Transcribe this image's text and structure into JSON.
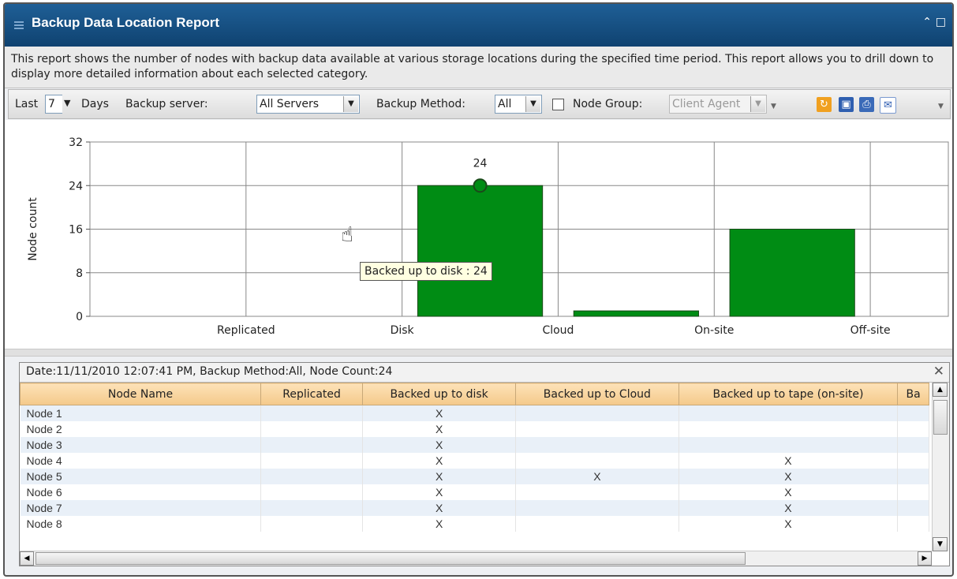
{
  "window": {
    "title": "Backup Data Location Report"
  },
  "description": "This report shows the number of nodes with backup data available at various storage locations during the specified time period. This report allows you to drill down to display more detailed information about each selected category.",
  "toolbar": {
    "last_label": "Last",
    "days_value": "7",
    "days_label": "Days",
    "server_label": "Backup server:",
    "server_value": "All Servers",
    "method_label": "Backup Method:",
    "method_value": "All",
    "node_group_label": "Node Group:",
    "node_group_value": "Client Agent",
    "icons": [
      "refresh-icon",
      "save-icon",
      "print-icon",
      "email-icon"
    ]
  },
  "chart_data": {
    "type": "bar",
    "categories": [
      "Replicated",
      "Disk",
      "Cloud",
      "On-site",
      "Off-site"
    ],
    "values": [
      0,
      24,
      1,
      16,
      0
    ],
    "ylabel": "Node count",
    "xlabel": "",
    "ylim": [
      0,
      32
    ],
    "yticks": [
      0,
      8,
      16,
      24,
      32
    ],
    "highlight": {
      "category": "Disk",
      "label": "24"
    },
    "bar_color": "#008c14",
    "grid": true
  },
  "tooltip": "Backed up to disk : 24",
  "detail": {
    "summary": "Date:11/11/2010 12:07:41 PM, Backup Method:All, Node Count:24",
    "columns": [
      "Node Name",
      "Replicated",
      "Backed up to disk",
      "Backed up to Cloud",
      "Backed up to tape (on-site)",
      "Ba"
    ],
    "rows": [
      [
        "Node 1",
        "",
        "X",
        "",
        "",
        ""
      ],
      [
        "Node 2",
        "",
        "X",
        "",
        "",
        ""
      ],
      [
        "Node 3",
        "",
        "X",
        "",
        "",
        ""
      ],
      [
        "Node 4",
        "",
        "X",
        "",
        "X",
        ""
      ],
      [
        "Node 5",
        "",
        "X",
        "X",
        "X",
        ""
      ],
      [
        "Node 6",
        "",
        "X",
        "",
        "X",
        ""
      ],
      [
        "Node 7",
        "",
        "X",
        "",
        "X",
        ""
      ],
      [
        "Node 8",
        "",
        "X",
        "",
        "X",
        ""
      ]
    ]
  }
}
